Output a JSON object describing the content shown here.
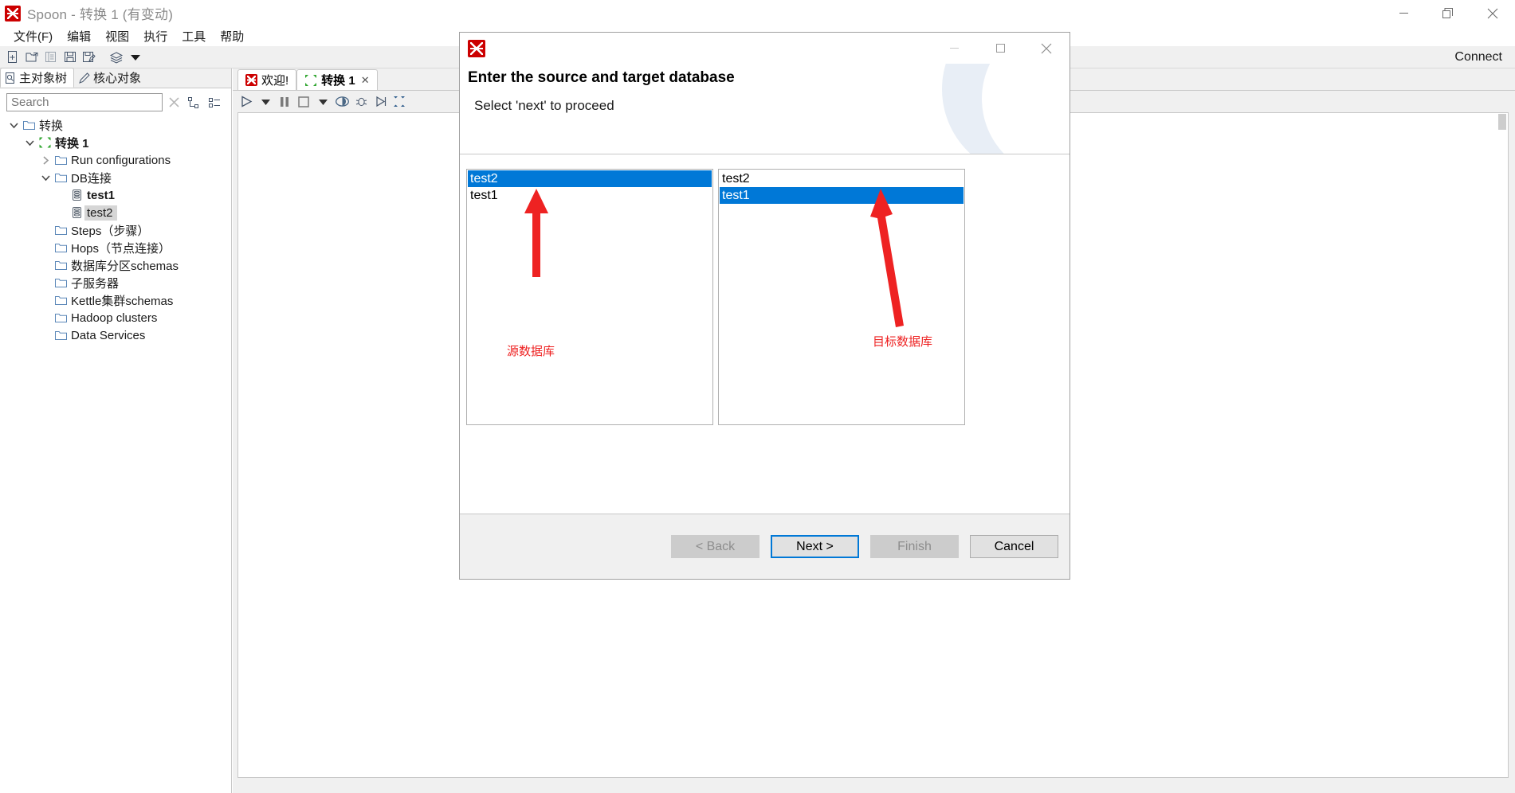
{
  "window": {
    "title": "Spoon - 转换 1 (有变动)",
    "app_icon": "kettle-icon",
    "controls": {
      "minimize": "minimize-icon",
      "restore": "restore-icon",
      "close": "close-icon"
    }
  },
  "menubar": {
    "items": [
      "文件(F)",
      "编辑",
      "视图",
      "执行",
      "工具",
      "帮助"
    ]
  },
  "toolbar": {
    "buttons": [
      {
        "name": "new-file-icon"
      },
      {
        "name": "open-file-icon"
      },
      {
        "name": "explore-repository-icon"
      },
      {
        "name": "save-icon"
      },
      {
        "name": "save-as-icon"
      },
      {
        "name": "layers-icon"
      },
      {
        "name": "dropdown-arrow-icon"
      }
    ],
    "connect_label": "Connect"
  },
  "left_panel": {
    "tabs": [
      {
        "label": "主对象树",
        "icon": "view-tree-icon",
        "active": true
      },
      {
        "label": "核心对象",
        "icon": "pencil-icon",
        "active": false
      }
    ],
    "search": {
      "placeholder": "Search",
      "value": ""
    },
    "search_clear_icon": "clear-x-icon",
    "tree_buttons": [
      {
        "name": "expand-all-icon"
      },
      {
        "name": "collapse-all-icon"
      }
    ],
    "tree": [
      {
        "label": "转换",
        "indent": 0,
        "expander": "down",
        "icon": "folder-icon",
        "bold": false,
        "selected": false
      },
      {
        "label": "转换 1",
        "indent": 1,
        "expander": "down",
        "icon": "transformation-icon",
        "bold": true,
        "selected": false
      },
      {
        "label": "Run configurations",
        "indent": 2,
        "expander": "right",
        "icon": "folder-icon",
        "bold": false,
        "selected": false
      },
      {
        "label": "DB连接",
        "indent": 2,
        "expander": "down",
        "icon": "folder-icon",
        "bold": false,
        "selected": false
      },
      {
        "label": "test1",
        "indent": 3,
        "expander": "none",
        "icon": "database-icon",
        "bold": true,
        "selected": false
      },
      {
        "label": "test2",
        "indent": 3,
        "expander": "none",
        "icon": "database-icon",
        "bold": false,
        "selected": true
      },
      {
        "label": "Steps（步骤）",
        "indent": 2,
        "expander": "none",
        "icon": "folder-icon",
        "bold": false,
        "selected": false
      },
      {
        "label": "Hops（节点连接）",
        "indent": 2,
        "expander": "none",
        "icon": "folder-icon",
        "bold": false,
        "selected": false
      },
      {
        "label": "数据库分区schemas",
        "indent": 2,
        "expander": "none",
        "icon": "folder-icon",
        "bold": false,
        "selected": false
      },
      {
        "label": "子服务器",
        "indent": 2,
        "expander": "none",
        "icon": "folder-icon",
        "bold": false,
        "selected": false
      },
      {
        "label": "Kettle集群schemas",
        "indent": 2,
        "expander": "none",
        "icon": "folder-icon",
        "bold": false,
        "selected": false
      },
      {
        "label": "Hadoop clusters",
        "indent": 2,
        "expander": "none",
        "icon": "folder-icon",
        "bold": false,
        "selected": false
      },
      {
        "label": "Data Services",
        "indent": 2,
        "expander": "none",
        "icon": "folder-icon",
        "bold": false,
        "selected": false
      }
    ]
  },
  "editor": {
    "tabs": [
      {
        "label": "欢迎!",
        "icon": "kettle-icon",
        "active": false,
        "closable": false
      },
      {
        "label": "转换 1",
        "icon": "transformation-icon",
        "active": true,
        "closable": true,
        "close_glyph": "✕"
      }
    ],
    "toolbar_buttons": [
      {
        "name": "run-icon"
      },
      {
        "name": "run-options-dropdown-icon"
      },
      {
        "name": "pause-icon"
      },
      {
        "name": "stop-icon"
      },
      {
        "name": "stop-options-dropdown-icon"
      },
      {
        "name": "preview-icon"
      },
      {
        "name": "debug-icon"
      },
      {
        "name": "replay-icon"
      },
      {
        "name": "verify-icon"
      }
    ]
  },
  "dialog": {
    "icon": "kettle-icon",
    "controls": {
      "minimize": "minimize-icon",
      "maximize": "maximize-icon",
      "close": "close-icon"
    },
    "title": "Enter the source and target database",
    "subtitle": "Select 'next' to proceed",
    "source_list": {
      "name": "source-database-list",
      "items": [
        {
          "label": "test2",
          "selected": true
        },
        {
          "label": "test1",
          "selected": false
        }
      ]
    },
    "target_list": {
      "name": "target-database-list",
      "items": [
        {
          "label": "test2",
          "selected": false
        },
        {
          "label": "test1",
          "selected": true
        }
      ]
    },
    "buttons": [
      {
        "label": "< Back",
        "state": "disabled",
        "name": "back-button"
      },
      {
        "label": "Next >",
        "state": "default",
        "name": "next-button"
      },
      {
        "label": "Finish",
        "state": "disabled",
        "name": "finish-button"
      },
      {
        "label": "Cancel",
        "state": "plain",
        "name": "cancel-button"
      }
    ]
  },
  "annotations": {
    "color": "#ee2222",
    "source_label": "源数据库",
    "target_label": "目标数据库"
  }
}
